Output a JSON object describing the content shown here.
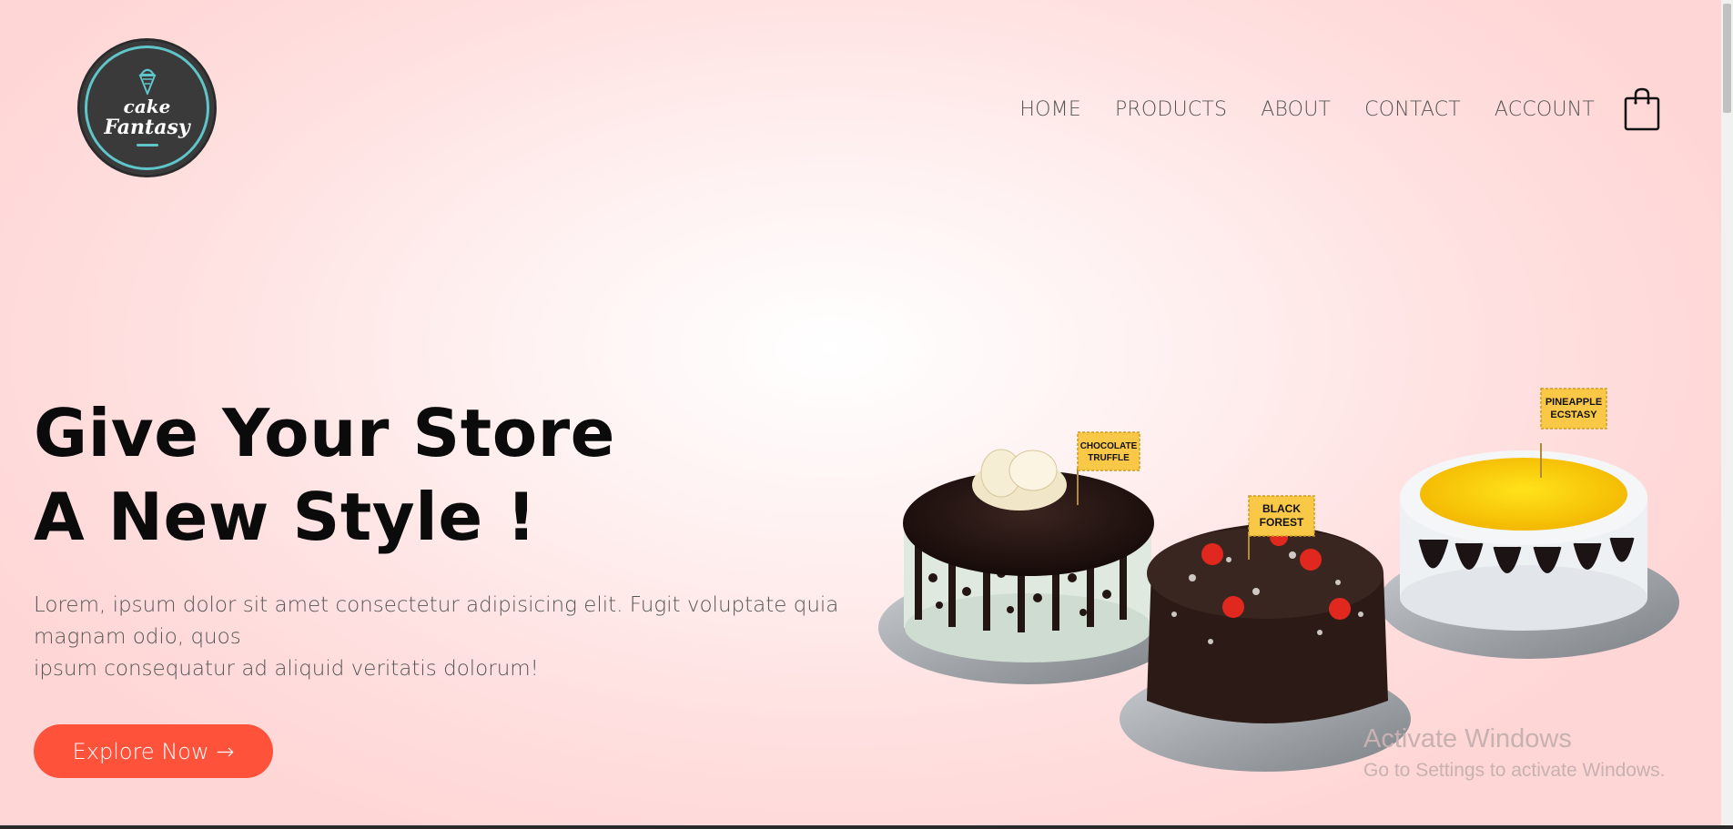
{
  "logo": {
    "line1": "cake",
    "line2": "Fantasy",
    "icon": "ice-cream-cone-icon"
  },
  "nav": {
    "items": [
      "HOME",
      "PRODUCTS",
      "ABOUT",
      "CONTACT",
      "ACCOUNT"
    ],
    "cart_icon": "shopping-bag-icon"
  },
  "hero": {
    "title_line1": "Give Your Store",
    "title_line2": "A New Style !",
    "description_line1": "Lorem, ipsum dolor sit amet consectetur adipisicing elit. Fugit voluptate quia magnam odio, quos",
    "description_line2": "ipsum consequatur ad aliquid veritatis dolorum!",
    "button_label": "Explore Now →"
  },
  "cakes": {
    "labels": [
      [
        "CHOCOLATE",
        "TRUFFLE"
      ],
      [
        "BLACK",
        "FOREST"
      ],
      [
        "PINEAPPLE",
        "ECSTASY"
      ]
    ]
  },
  "watermark": {
    "title": "Activate Windows",
    "subtitle": "Go to Settings to activate Windows."
  },
  "colors": {
    "accent": "#ff523b",
    "logo_teal": "#5fc5c8",
    "logo_bg": "#3a3a3a"
  }
}
